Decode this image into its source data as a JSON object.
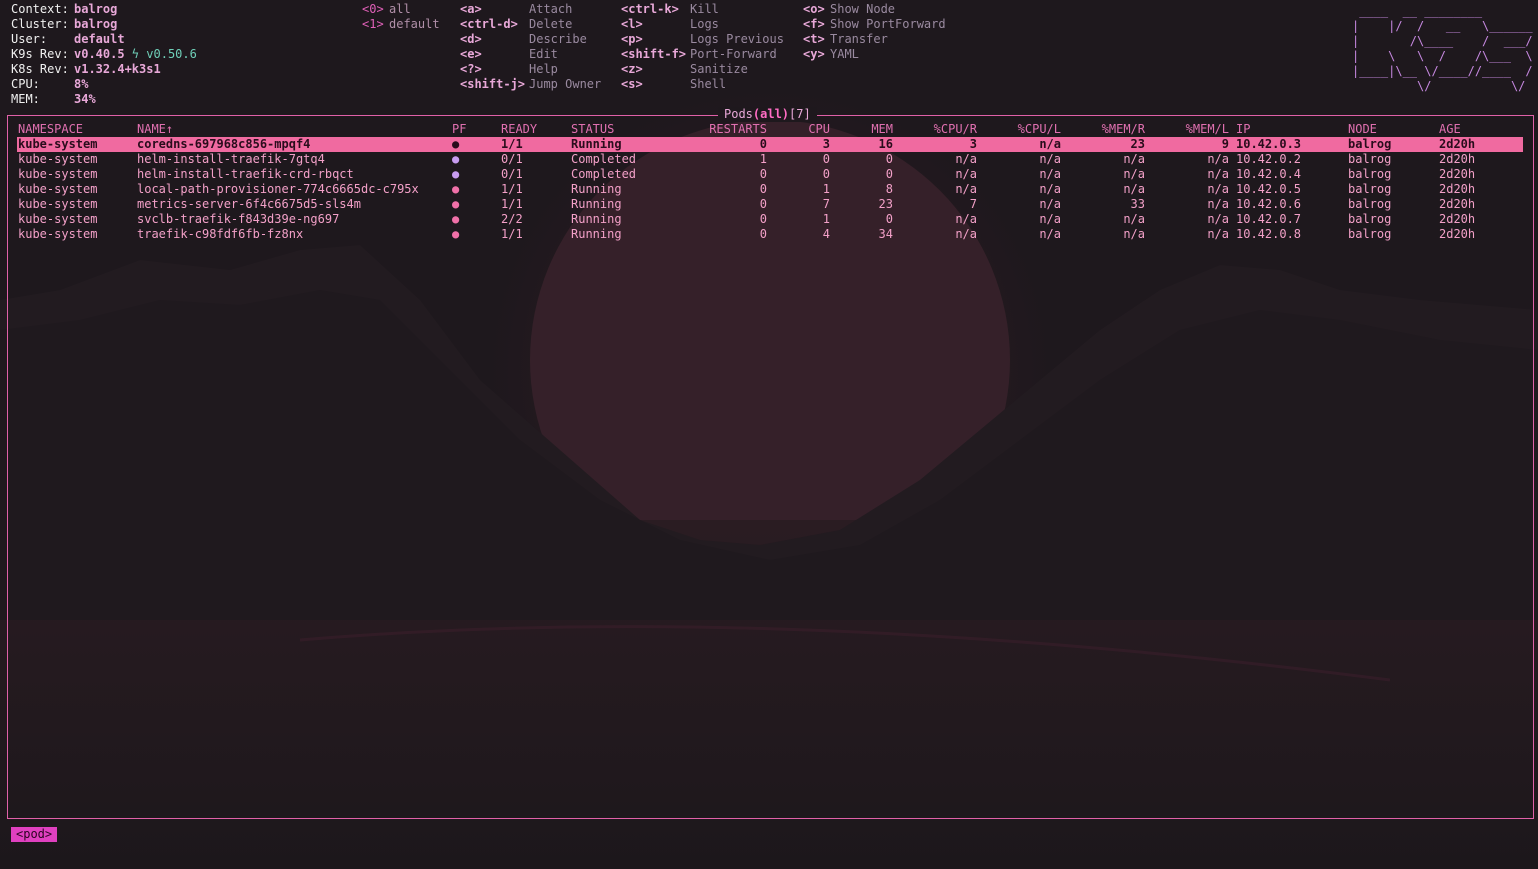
{
  "header": {
    "info": [
      {
        "label": "Context:",
        "value": "balrog"
      },
      {
        "label": "Cluster:",
        "value": "balrog"
      },
      {
        "label": "User:",
        "value": "default"
      },
      {
        "label": "K9s Rev:",
        "value": "v0.40.5",
        "icon": "lightning-icon",
        "extra": "v0.50.6"
      },
      {
        "label": "K8s Rev:",
        "value": "v1.32.4+k3s1"
      },
      {
        "label": "CPU:",
        "value": "8%"
      },
      {
        "label": "MEM:",
        "value": "34%"
      }
    ],
    "namespaces": [
      {
        "key": "<0>",
        "label": "all"
      },
      {
        "key": "<1>",
        "label": "default"
      }
    ],
    "hotkeys_col1": [
      {
        "key": "<a>",
        "label": "Attach"
      },
      {
        "key": "<ctrl-d>",
        "label": "Delete"
      },
      {
        "key": "<d>",
        "label": "Describe"
      },
      {
        "key": "<e>",
        "label": "Edit"
      },
      {
        "key": "<?>",
        "label": "Help"
      },
      {
        "key": "<shift-j>",
        "label": "Jump Owner"
      }
    ],
    "hotkeys_col2": [
      {
        "key": "<ctrl-k>",
        "label": "Kill"
      },
      {
        "key": "<l>",
        "label": "Logs"
      },
      {
        "key": "<p>",
        "label": "Logs Previous"
      },
      {
        "key": "<shift-f>",
        "label": "Port-Forward"
      },
      {
        "key": "<z>",
        "label": "Sanitize"
      },
      {
        "key": "<s>",
        "label": "Shell"
      }
    ],
    "hotkeys_col3": [
      {
        "key": "<o>",
        "label": "Show Node"
      },
      {
        "key": "<f>",
        "label": "Show PortForward"
      },
      {
        "key": "<t>",
        "label": "Transfer"
      },
      {
        "key": "<y>",
        "label": "YAML"
      }
    ],
    "logo_lines": [
      " ____  __ ________       ",
      "|    |/  /   __   \\______",
      "|       /\\____    /  ___/",
      "|    \\   \\  /    /\\___  \\",
      "|____|\\__ \\/____//____  /",
      "         \\/           \\/ "
    ]
  },
  "view": {
    "title": "Pods",
    "scope": "(all)",
    "count": "[7]"
  },
  "table": {
    "columns": [
      "NAMESPACE",
      "NAME↑",
      "PF",
      "READY",
      "STATUS",
      "RESTARTS",
      "CPU",
      "MEM",
      "%CPU/R",
      "%CPU/L",
      "%MEM/R",
      "%MEM/L",
      "IP",
      "NODE",
      "AGE"
    ],
    "rows": [
      {
        "namespace": "kube-system",
        "name": "coredns-697968c856-mpqf4",
        "pf": "●",
        "pf_color": "#f070a8",
        "ready": "1/1",
        "status": "Running",
        "restarts": "0",
        "cpu": "3",
        "mem": "16",
        "cpu_r": "3",
        "cpu_l": "n/a",
        "mem_r": "23",
        "mem_l": "9",
        "ip": "10.42.0.3",
        "node": "balrog",
        "age": "2d20h",
        "selected": true
      },
      {
        "namespace": "kube-system",
        "name": "helm-install-traefik-7gtq4",
        "pf": "●",
        "pf_color": "#c89cf0",
        "ready": "0/1",
        "status": "Completed",
        "restarts": "1",
        "cpu": "0",
        "mem": "0",
        "cpu_r": "n/a",
        "cpu_l": "n/a",
        "mem_r": "n/a",
        "mem_l": "n/a",
        "ip": "10.42.0.2",
        "node": "balrog",
        "age": "2d20h"
      },
      {
        "namespace": "kube-system",
        "name": "helm-install-traefik-crd-rbqct",
        "pf": "●",
        "pf_color": "#c89cf0",
        "ready": "0/1",
        "status": "Completed",
        "restarts": "0",
        "cpu": "0",
        "mem": "0",
        "cpu_r": "n/a",
        "cpu_l": "n/a",
        "mem_r": "n/a",
        "mem_l": "n/a",
        "ip": "10.42.0.4",
        "node": "balrog",
        "age": "2d20h"
      },
      {
        "namespace": "kube-system",
        "name": "local-path-provisioner-774c6665dc-c795x",
        "pf": "●",
        "pf_color": "#f070a8",
        "ready": "1/1",
        "status": "Running",
        "restarts": "0",
        "cpu": "1",
        "mem": "8",
        "cpu_r": "n/a",
        "cpu_l": "n/a",
        "mem_r": "n/a",
        "mem_l": "n/a",
        "ip": "10.42.0.5",
        "node": "balrog",
        "age": "2d20h"
      },
      {
        "namespace": "kube-system",
        "name": "metrics-server-6f4c6675d5-sls4m",
        "pf": "●",
        "pf_color": "#f070a8",
        "ready": "1/1",
        "status": "Running",
        "restarts": "0",
        "cpu": "7",
        "mem": "23",
        "cpu_r": "7",
        "cpu_l": "n/a",
        "mem_r": "33",
        "mem_l": "n/a",
        "ip": "10.42.0.6",
        "node": "balrog",
        "age": "2d20h"
      },
      {
        "namespace": "kube-system",
        "name": "svclb-traefik-f843d39e-ng697",
        "pf": "●",
        "pf_color": "#f070a8",
        "ready": "2/2",
        "status": "Running",
        "restarts": "0",
        "cpu": "1",
        "mem": "0",
        "cpu_r": "n/a",
        "cpu_l": "n/a",
        "mem_r": "n/a",
        "mem_l": "n/a",
        "ip": "10.42.0.7",
        "node": "balrog",
        "age": "2d20h"
      },
      {
        "namespace": "kube-system",
        "name": "traefik-c98fdf6fb-fz8nx",
        "pf": "●",
        "pf_color": "#f070a8",
        "ready": "1/1",
        "status": "Running",
        "restarts": "0",
        "cpu": "4",
        "mem": "34",
        "cpu_r": "n/a",
        "cpu_l": "n/a",
        "mem_r": "n/a",
        "mem_l": "n/a",
        "ip": "10.42.0.8",
        "node": "balrog",
        "age": "2d20h"
      }
    ]
  },
  "footer": {
    "crumb": "<pod>"
  }
}
